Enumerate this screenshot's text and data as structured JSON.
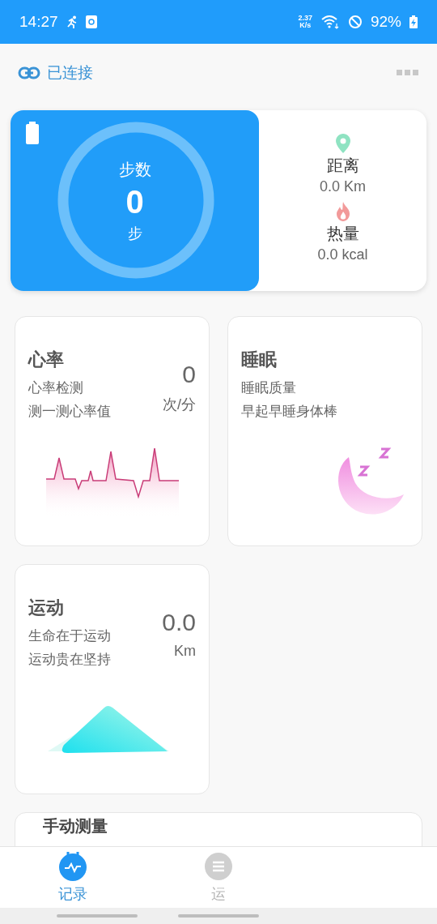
{
  "status_bar": {
    "time": "14:27",
    "speed_value": "2.37",
    "speed_unit": "K/s",
    "battery": "92%"
  },
  "header": {
    "connection": "已连接"
  },
  "steps_card": {
    "label": "步数",
    "value": "0",
    "unit": "步",
    "level": 0,
    "distance": {
      "label": "距离",
      "value": "0.0 Km"
    },
    "calories": {
      "label": "热量",
      "value": "0.0 kcal"
    }
  },
  "cards": [
    {
      "kind": "heart_rate",
      "title": "心率",
      "lines": [
        "心率检测",
        "测一测心率值"
      ],
      "value": "0",
      "unit": "次/分"
    },
    {
      "kind": "sleep",
      "title": "睡眠",
      "lines": [
        "睡眠质量",
        "早起早睡身体棒"
      ]
    },
    {
      "kind": "exercise",
      "title": "运动",
      "lines": [
        "生命在于运动",
        "运动贵在坚持"
      ],
      "value": "0.0",
      "unit": "Km"
    }
  ],
  "manual_card": {
    "title": "手动测量"
  },
  "bottom_nav": [
    {
      "label": "记录",
      "selected": true
    },
    {
      "label": "运",
      "selected": false
    }
  ]
}
